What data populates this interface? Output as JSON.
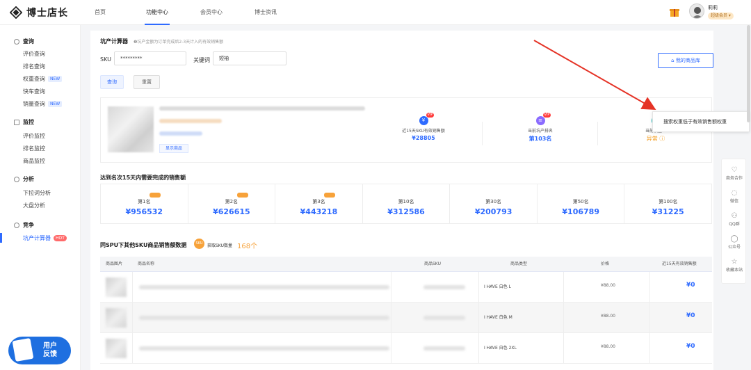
{
  "header": {
    "logo_text": "博士店长",
    "nav": [
      "首页",
      "功能中心",
      "会员中心",
      "博士资讯"
    ],
    "user_name": "莉莉",
    "vip_label": "超级会员 ▾"
  },
  "sidebar": {
    "sections": [
      {
        "title": "查询",
        "items": [
          {
            "label": "评价查询"
          },
          {
            "label": "排名查询"
          },
          {
            "label": "权重查询",
            "tag": "NEW"
          },
          {
            "label": "快车查询"
          },
          {
            "label": "销量查询",
            "tag": "NEW"
          }
        ]
      },
      {
        "title": "监控",
        "items": [
          {
            "label": "评价监控"
          },
          {
            "label": "排名监控"
          },
          {
            "label": "商品监控"
          }
        ]
      },
      {
        "title": "分析",
        "items": [
          {
            "label": "下拉词分析"
          },
          {
            "label": "大盘分析"
          }
        ]
      },
      {
        "title": "竞争",
        "items": [
          {
            "label": "坑产计算器",
            "tag": "HOT"
          }
        ]
      }
    ],
    "feedback": {
      "line1": "用户",
      "line2": "反馈"
    }
  },
  "calculator": {
    "title": "坑产计算器",
    "hint": "❶坑产金额为订单完成后2-3天计入的有效销售额",
    "sku_label": "SKU",
    "sku_value": "*********",
    "keyword_label": "关键词",
    "keyword_value": "短袖",
    "query_btn": "查询",
    "reset_btn": "重置",
    "my_lib_btn": "我的商品库"
  },
  "product": {
    "show_btn": "显示商品",
    "metrics": [
      {
        "label": "近15天SKU有效销售额",
        "value": "¥28805",
        "vip": "VIP",
        "icon": "¥",
        "color": "#2f6bff"
      },
      {
        "label": "当前坑产排名",
        "value": "第103名",
        "vip": "VIP",
        "icon": "≡",
        "color": "#8a6bff"
      },
      {
        "label": "当前权重…",
        "value": "异常 ⓘ",
        "icon": "◐",
        "color": "#16b8b8"
      }
    ],
    "tooltip": "搜索权重低于有效销售额权重"
  },
  "ranks": {
    "title": "达到名次15天内需要完成的销售额",
    "items": [
      {
        "label": "第1名",
        "value": "¥956532",
        "badge": true
      },
      {
        "label": "第2名",
        "value": "¥626615",
        "badge": true
      },
      {
        "label": "第3名",
        "value": "¥443218",
        "badge": true
      },
      {
        "label": "第10名",
        "value": "¥312586",
        "badge": false
      },
      {
        "label": "第30名",
        "value": "¥200793",
        "badge": false
      },
      {
        "label": "第50名",
        "value": "¥106789",
        "badge": false
      },
      {
        "label": "第100名",
        "value": "¥31225",
        "badge": false
      }
    ]
  },
  "sku_table": {
    "title": "同SPU下其他SKU商品销售额数据",
    "sku_circle": "SKU",
    "sku_count_label": "获取SKU数量",
    "sku_count": "168个",
    "columns": [
      "商品图片",
      "商品名称",
      "商品SKU",
      "商品类型",
      "价格",
      "近15天有效销售额"
    ],
    "rows": [
      {
        "type": "I HAVE 白色  L",
        "price": "¥88.00",
        "sales": "¥0"
      },
      {
        "type": "I HAVE 白色  M",
        "price": "¥88.00",
        "sales": "¥0"
      },
      {
        "type": "I HAVE 白色  2XL",
        "price": "¥88.00",
        "sales": "¥0"
      }
    ]
  },
  "float_panel": [
    {
      "label": "商务合作",
      "icon": "♡"
    },
    {
      "label": "微信",
      "icon": "◌"
    },
    {
      "label": "QQ群",
      "icon": "⚇"
    },
    {
      "label": "公众号",
      "icon": "◯"
    },
    {
      "label": "收藏本站",
      "icon": "☆"
    }
  ],
  "colors": {
    "accent": "#2f6bff",
    "warn": "#f39b1a",
    "badge": "#f7a23a",
    "arrow": "#e53326"
  }
}
